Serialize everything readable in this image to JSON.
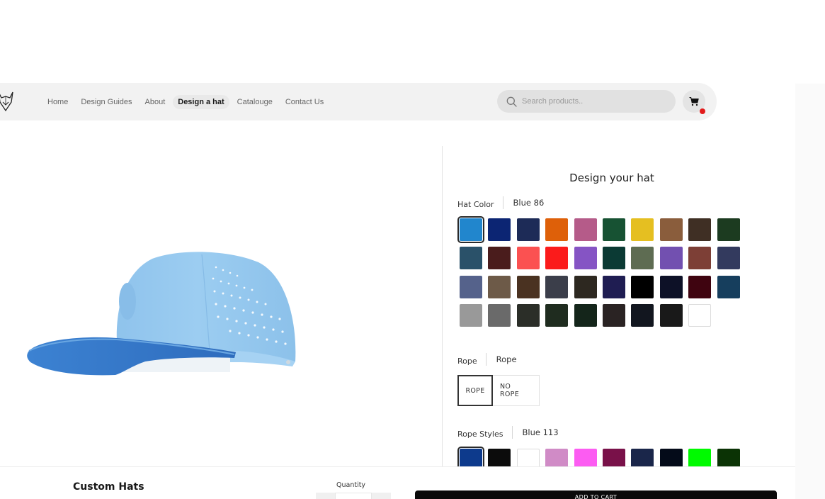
{
  "nav": {
    "links": [
      "Home",
      "Design Guides",
      "About",
      "Design a hat",
      "Catalouge",
      "Contact Us"
    ],
    "active_index": 3,
    "search_placeholder": "Search products..",
    "cart_badge_color": "#e21b1b"
  },
  "panel": {
    "title": "Design your hat",
    "hat_color": {
      "label": "Hat Color",
      "value": "Blue 86",
      "selected_index": 0,
      "swatches": [
        "#2186cd",
        "#0c2573",
        "#1d2b57",
        "#de6009",
        "#b55b89",
        "#175233",
        "#e5bf21",
        "#8a5d3c",
        "#3f2f24",
        "#1c3b20",
        "#2a5169",
        "#4a1c1c",
        "#fb5151",
        "#fb1b1b",
        "#8554c4",
        "#0b3a34",
        "#5e6c52",
        "#7250b0",
        "#7d3f36",
        "#333a5e",
        "#55628b",
        "#6d5a48",
        "#4a3221",
        "#3b3e4a",
        "#2d2820",
        "#1f1d52",
        "#000000",
        "#0d1127",
        "#3f0410",
        "#163e5d",
        "#999999",
        "#6a6a6a",
        "#2b2e28",
        "#1f2c1f",
        "#14251a",
        "#2a2323",
        "#12161f",
        "#191919",
        "#ffffff"
      ]
    },
    "rope": {
      "label": "Rope",
      "value": "Rope",
      "options": [
        "ROPE",
        "NO ROPE"
      ],
      "selected_index": 0
    },
    "rope_styles": {
      "label": "Rope Styles",
      "value": "Blue 113",
      "selected_index": 0,
      "swatches": [
        "#0d3a8c",
        "#0c0c0c",
        "#ffffff",
        "#d08bc6",
        "#fc5cf2",
        "#791149",
        "#1a264a",
        "#040b19",
        "#00fa00",
        "#0b3305",
        "#431a44"
      ]
    }
  },
  "bottom": {
    "product_name": "Custom Hats",
    "quantity_label": "Quantity",
    "add_to_cart_label": "ADD TO CART"
  }
}
